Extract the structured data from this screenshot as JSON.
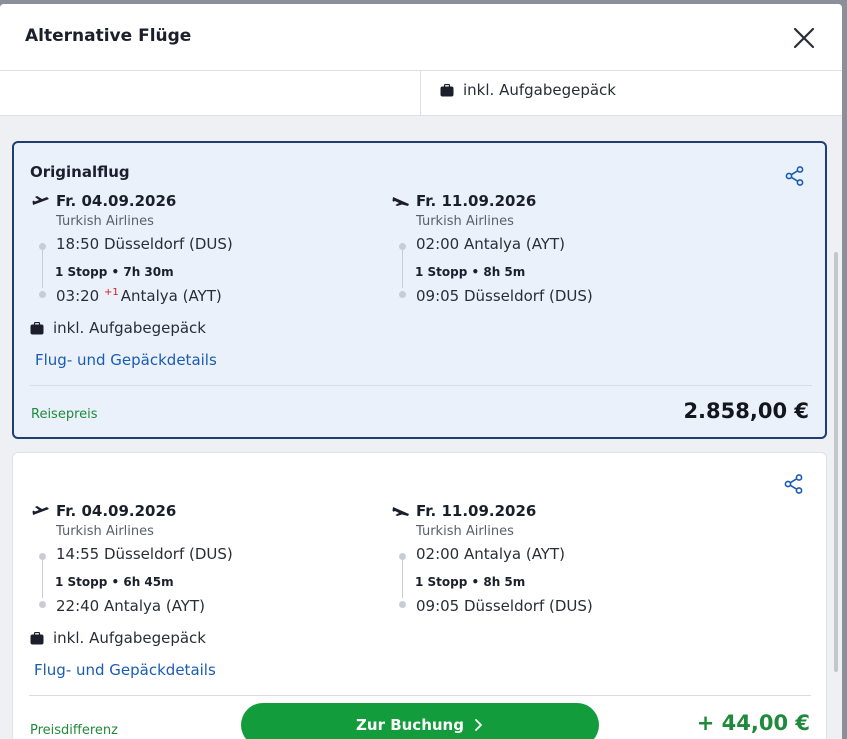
{
  "modal": {
    "title": "Alternative Flüge"
  },
  "previous_card": {
    "baggage": "inkl. Aufgabegepäck"
  },
  "original": {
    "label": "Originalflug",
    "outbound": {
      "date": "Fr. 04.09.2026",
      "airline": "Turkish Airlines",
      "departure": "18:50 Düsseldorf (DUS)",
      "stops": "1 Stopp • 7h 30m",
      "arrival_time": "03:20",
      "arrival_day_offset": "+1",
      "arrival_place": "Antalya (AYT)"
    },
    "return": {
      "date": "Fr. 11.09.2026",
      "airline": "Turkish Airlines",
      "departure": "02:00 Antalya (AYT)",
      "stops": "1 Stopp • 8h 5m",
      "arrival": "09:05 Düsseldorf (DUS)"
    },
    "baggage": "inkl. Aufgabegepäck",
    "details_link": "Flug- und Gepäckdetails",
    "price_label": "Reisepreis",
    "price": "2.858,00 €"
  },
  "alternative": {
    "outbound": {
      "date": "Fr. 04.09.2026",
      "airline": "Turkish Airlines",
      "departure": "14:55 Düsseldorf (DUS)",
      "stops": "1 Stopp • 6h 45m",
      "arrival": "22:40 Antalya (AYT)"
    },
    "return": {
      "date": "Fr. 11.09.2026",
      "airline": "Turkish Airlines",
      "departure": "02:00 Antalya (AYT)",
      "stops": "1 Stopp • 8h 5m",
      "arrival": "09:05 Düsseldorf (DUS)"
    },
    "baggage": "inkl. Aufgabegepäck",
    "details_link": "Flug- und Gepäckdetails",
    "price_label": "Preisdifferenz",
    "book_button": "Zur Buchung",
    "price_diff": "+ 44,00 €"
  },
  "colors": {
    "accent_green": "#139c3c",
    "link_blue": "#1a5cb0",
    "selected_border": "#1f3f70"
  },
  "icons": [
    "close-icon",
    "suitcase-icon",
    "share-icon",
    "plane-departure-icon",
    "plane-arrival-icon",
    "chevron-right-icon"
  ]
}
